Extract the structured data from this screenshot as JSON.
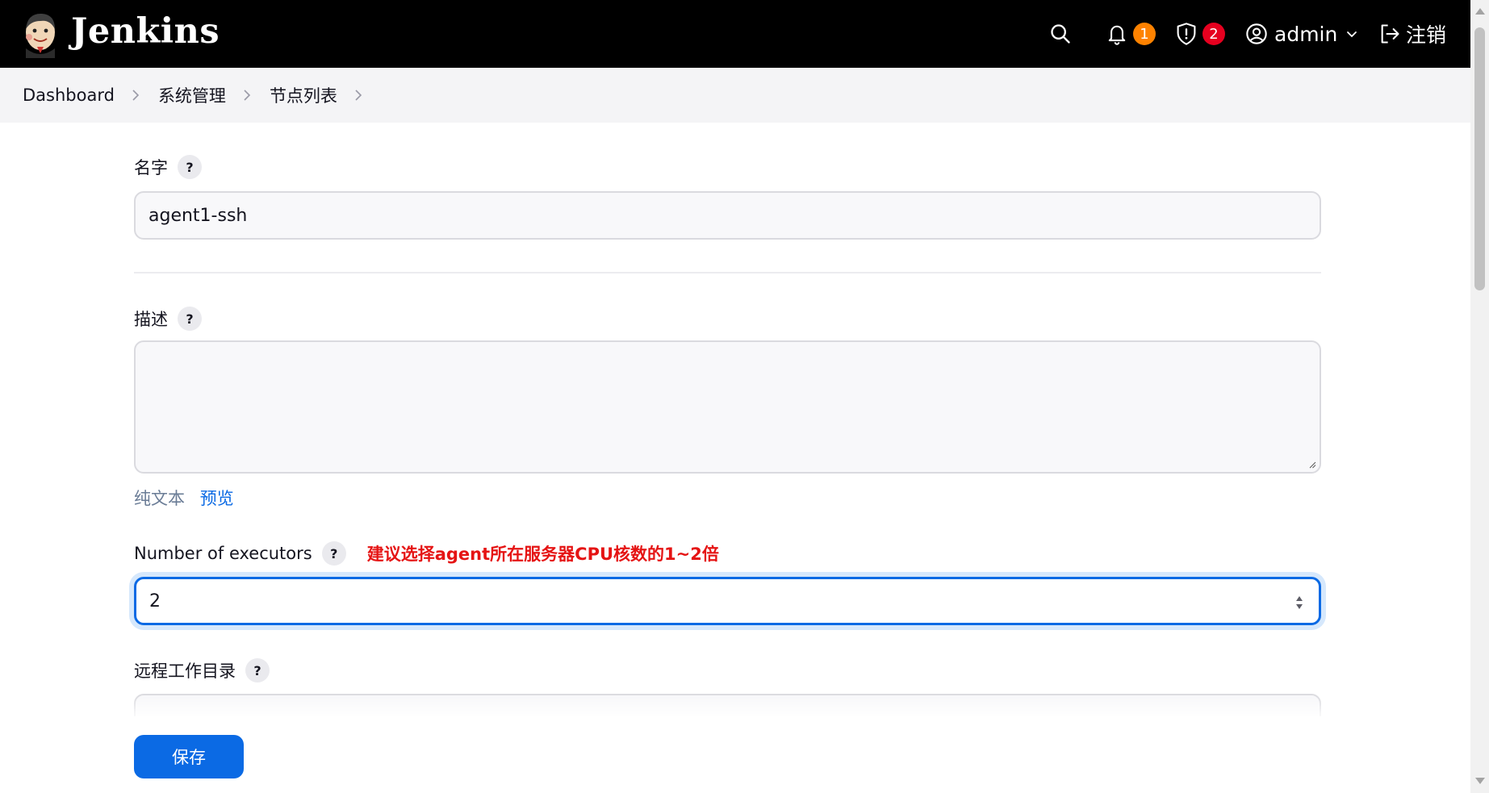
{
  "header": {
    "brand": "Jenkins",
    "notifications_count": "1",
    "security_count": "2",
    "user": "admin",
    "logout_label": "注销"
  },
  "breadcrumb": {
    "items": [
      "Dashboard",
      "系统管理",
      "节点列表"
    ]
  },
  "form": {
    "name": {
      "label": "名字",
      "help": "?",
      "value": "agent1-ssh"
    },
    "description": {
      "label": "描述",
      "help": "?",
      "value": ""
    },
    "markup": {
      "plain": "纯文本",
      "preview": "预览"
    },
    "executors": {
      "label": "Number of executors",
      "help": "?",
      "note": "建议选择agent所在服务器CPU核数的1~2倍",
      "value": "2"
    },
    "remote_dir": {
      "label": "远程工作目录",
      "help": "?"
    }
  },
  "actions": {
    "save": "保存"
  },
  "colors": {
    "accent": "#0b6ae4",
    "header_bg": "#000000",
    "warning_badge": "#fe8200",
    "danger_badge": "#e6001f",
    "note": "#e51414"
  }
}
